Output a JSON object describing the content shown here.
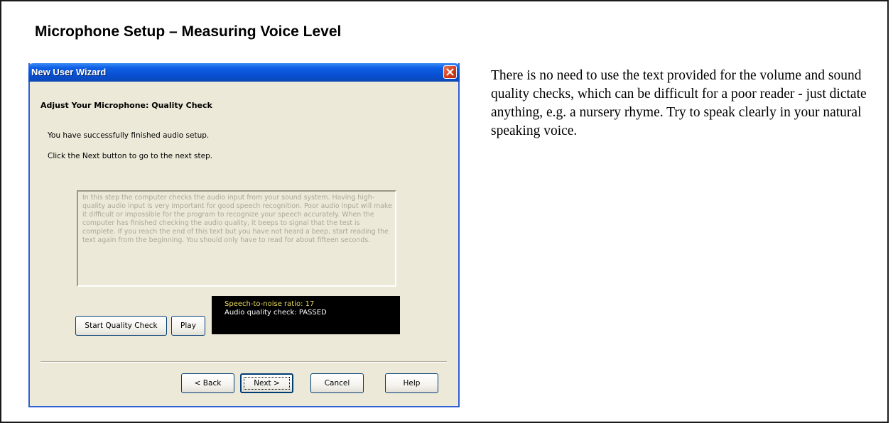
{
  "slide": {
    "title": "Microphone Setup – Measuring Voice Level",
    "body_text": "There is no need to use the text provided for the volume and sound quality checks, which can be difficult for a poor reader - just dictate anything, e.g. a nursery rhyme. Try to speak clearly in your natural speaking voice."
  },
  "wizard": {
    "title": "New User Wizard",
    "close_icon": "close-x-icon",
    "heading": "Adjust Your Microphone: Quality Check",
    "info_line_1": "You have successfully finished audio setup.",
    "info_line_2": "Click the Next button to go to the next step.",
    "reading_text": "In this step the computer checks the audio input from your sound system. Having high-quality audio input is very important for good speech recognition. Poor audio input will make it difficult or impossible for the program to recognize your speech accurately. When the computer has finished checking the audio quality, it beeps to signal that the test is complete. If you reach the end of this text but you have not heard a beep, start reading the text again from the beginning. You should only have to read for about fifteen seconds.",
    "buttons": {
      "start_quality_check": "Start Quality Check",
      "play": "Play",
      "back": "< Back",
      "next": "Next >",
      "cancel": "Cancel",
      "help": "Help"
    },
    "status": {
      "line1": "Speech-to-noise ratio:  17",
      "line2": "Audio quality check: PASSED"
    }
  },
  "colors": {
    "titlebar_blue": "#0850d2",
    "dialog_bg": "#ece9d8",
    "status_bg": "#000000",
    "status_text_yellow": "#e8d85a",
    "close_red": "#d43c1b"
  }
}
